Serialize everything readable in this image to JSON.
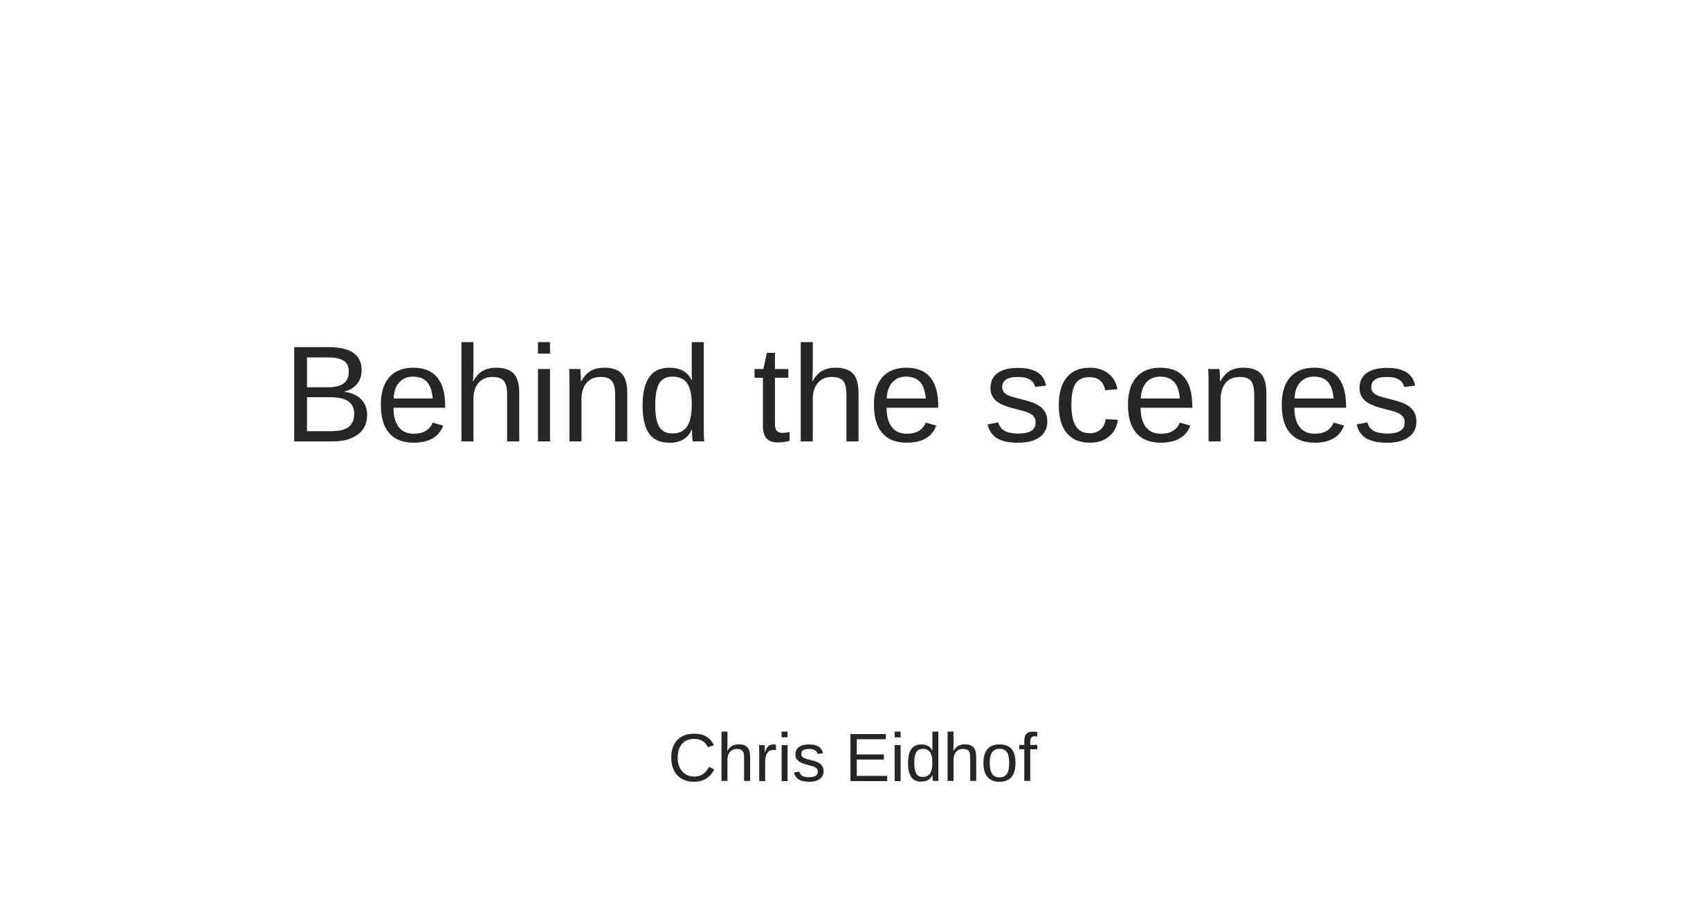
{
  "slide": {
    "title": "Behind the scenes",
    "author": "Chris Eidhof"
  },
  "colors": {
    "background": "#ffffff",
    "text": "#262626"
  }
}
